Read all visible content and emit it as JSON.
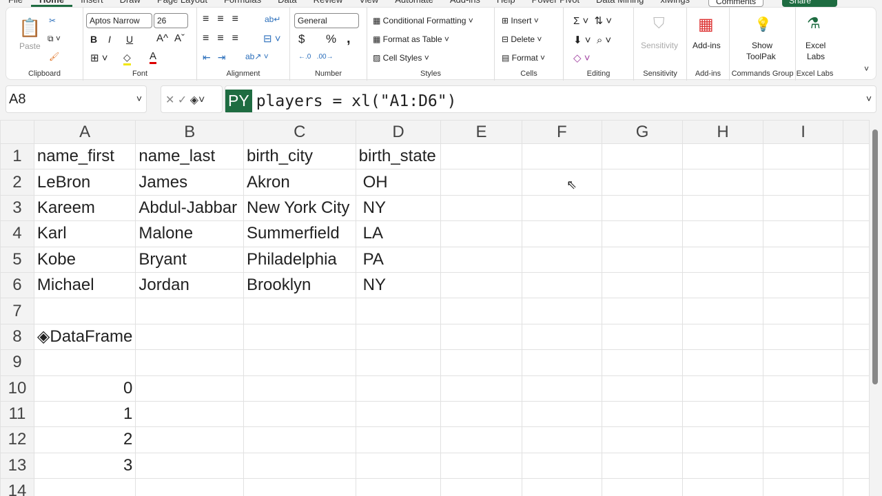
{
  "tabs": [
    "File",
    "Home",
    "Insert",
    "Draw",
    "Page Layout",
    "Formulas",
    "Data",
    "Review",
    "View",
    "Automate",
    "Add-ins",
    "Help",
    "Power Pivot",
    "Data Mining",
    "xlwings"
  ],
  "comments_label": "Comments",
  "share_label": "Share",
  "ribbon": {
    "clipboard": {
      "label": "Clipboard",
      "paste": "Paste"
    },
    "font": {
      "label": "Font",
      "name": "Aptos Narrow",
      "size": "26",
      "bold": "B",
      "italic": "I",
      "underline": "U",
      "grow": "A^",
      "shrink": "Aˇ",
      "color": "A"
    },
    "alignment": {
      "label": "Alignment"
    },
    "number": {
      "label": "Number",
      "format": "General",
      "currency": "$",
      "percent": "%",
      "comma": ","
    },
    "styles": {
      "label": "Styles",
      "cond": "Conditional Formatting",
      "table": "Format as Table",
      "cell": "Cell Styles"
    },
    "cells": {
      "label": "Cells",
      "insert": "Insert",
      "delete": "Delete",
      "format": "Format"
    },
    "editing": {
      "label": "Editing"
    },
    "sensitivity": {
      "label": "Sensitivity",
      "btn": "Sensitivity"
    },
    "addins": {
      "label": "Add-ins",
      "btn": "Add-ins"
    },
    "commands": {
      "label": "Commands Group",
      "btn1": "Show",
      "btn2": "ToolPak"
    },
    "labs": {
      "label": "Excel Labs",
      "btn1": "Excel",
      "btn2": "Labs"
    }
  },
  "name_box": "A8",
  "formula": {
    "badge": "PY",
    "text": "players = xl(\"A1:D6\")"
  },
  "columns": [
    "A",
    "B",
    "C",
    "D",
    "E",
    "F",
    "G",
    "H",
    "I"
  ],
  "rows": [
    [
      "name_first",
      "name_last",
      "birth_city",
      "birth_state"
    ],
    [
      "LeBron",
      "James",
      "Akron",
      "OH"
    ],
    [
      "Kareem",
      "Abdul-Jabbar",
      "New York City",
      "NY"
    ],
    [
      "Karl",
      "Malone",
      "Summerfield",
      "LA"
    ],
    [
      "Kobe",
      "Bryant",
      "Philadelphia",
      "PA"
    ],
    [
      "Michael",
      "Jordan",
      "Brooklyn",
      "NY"
    ]
  ],
  "a8": "DataFrame",
  "index_values": [
    "0",
    "1",
    "2",
    "3"
  ],
  "row_numbers": [
    "1",
    "2",
    "3",
    "4",
    "5",
    "6",
    "7",
    "8",
    "9",
    "10",
    "11",
    "12",
    "13",
    "14"
  ]
}
